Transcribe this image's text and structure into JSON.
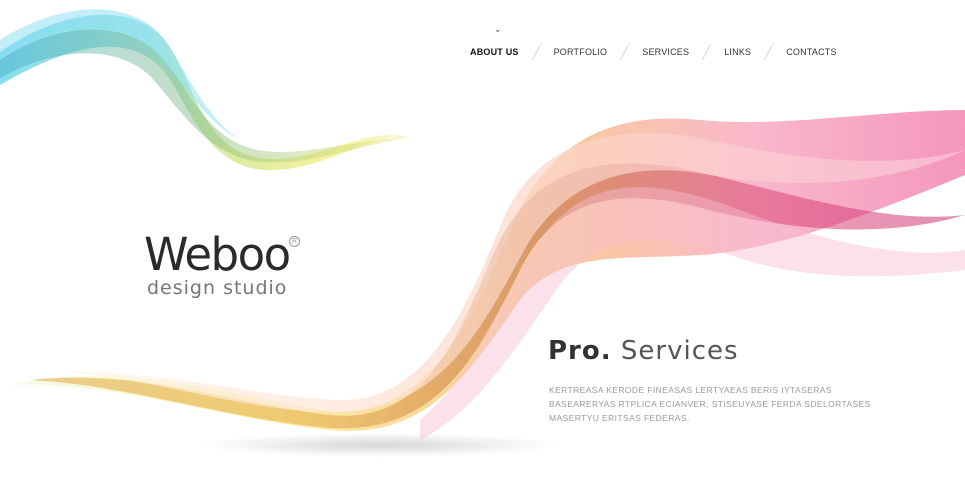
{
  "header": {
    "indicator_icon": "chevron-down-icon",
    "indicator_glyph": "⌄"
  },
  "nav": {
    "items": [
      {
        "label": "ABOUT US",
        "active": true
      },
      {
        "label": "PORTFOLIO",
        "active": false
      },
      {
        "label": "SERVICES",
        "active": false
      },
      {
        "label": "LINKS",
        "active": false
      },
      {
        "label": "CONTACTS",
        "active": false
      }
    ]
  },
  "logo": {
    "name": "Weboo",
    "registered": "R",
    "tagline": "design studio"
  },
  "promo": {
    "title_bold": "Pro.",
    "title_light": "Services",
    "body_lines": [
      "KERTREASA KERODE FINEASAS LERTYAEAS BERIS IYTASERAS",
      "BASEARERYAS RTPLICA ECIANVER, STISEUYASE FERDA SDELORTASES",
      "MASERTYU ERITSAS FEDERAS."
    ]
  },
  "colors": {
    "wave_cyan": "#4fd0e8",
    "wave_yellow": "#f2ec6a",
    "wave_orange": "#f6a23a",
    "wave_pink": "#ec4e8a"
  }
}
